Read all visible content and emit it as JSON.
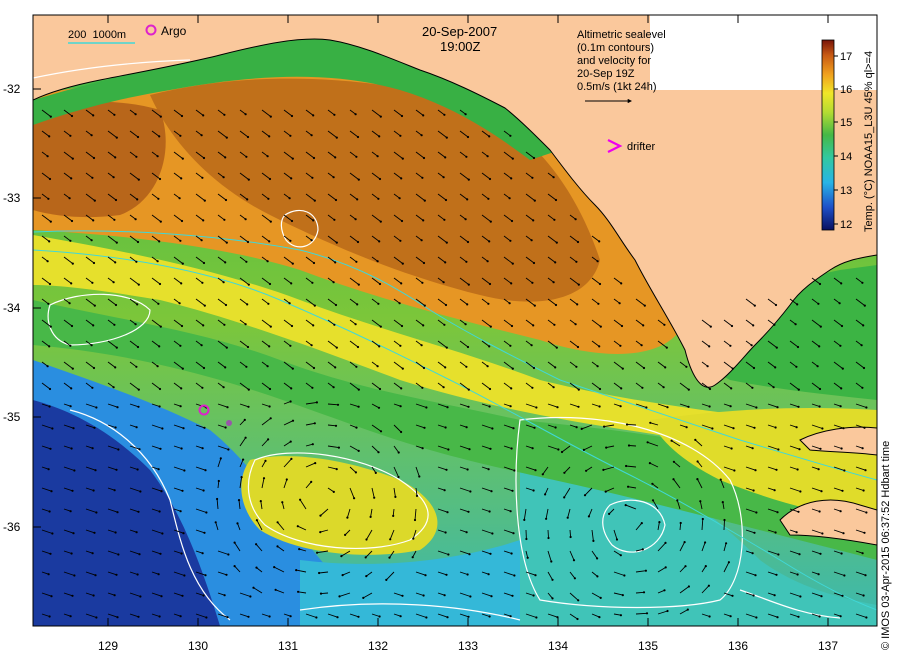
{
  "map": {
    "date": "20-Sep-2007",
    "time": "19:00Z",
    "scale_label": "200  1000m",
    "argo_label": "Argo",
    "drifter_label": "drifter",
    "altimetry_lines": [
      "Altimetric sealevel",
      "(0.1m contours)",
      "and velocity for",
      "20-Sep 19Z",
      "0.5m/s (1kt 24h)"
    ],
    "lat_ticks": [
      "-32",
      "-33",
      "-34",
      "-35",
      "-36"
    ],
    "lon_ticks": [
      "129",
      "130",
      "131",
      "132",
      "133",
      "134",
      "135",
      "136",
      "137"
    ],
    "colorbar": {
      "ticks": [
        "12",
        "13",
        "14",
        "15",
        "16",
        "17"
      ],
      "title": "Temp. (°C) NOAA15_L3U 45% ql>=4"
    },
    "credit": "© IMOS 03-Apr-2015 06:37:52 Hdbart time",
    "colors": {
      "land": "#fac89c",
      "sst_warm": "#c86e14",
      "sst_mid": "#f0dc28",
      "sst_green": "#46b846",
      "sst_cool": "#3cc8c8",
      "sst_cold": "#1e3c9c",
      "argo": "#dd22cc",
      "drifter": "#ee00ee"
    }
  }
}
